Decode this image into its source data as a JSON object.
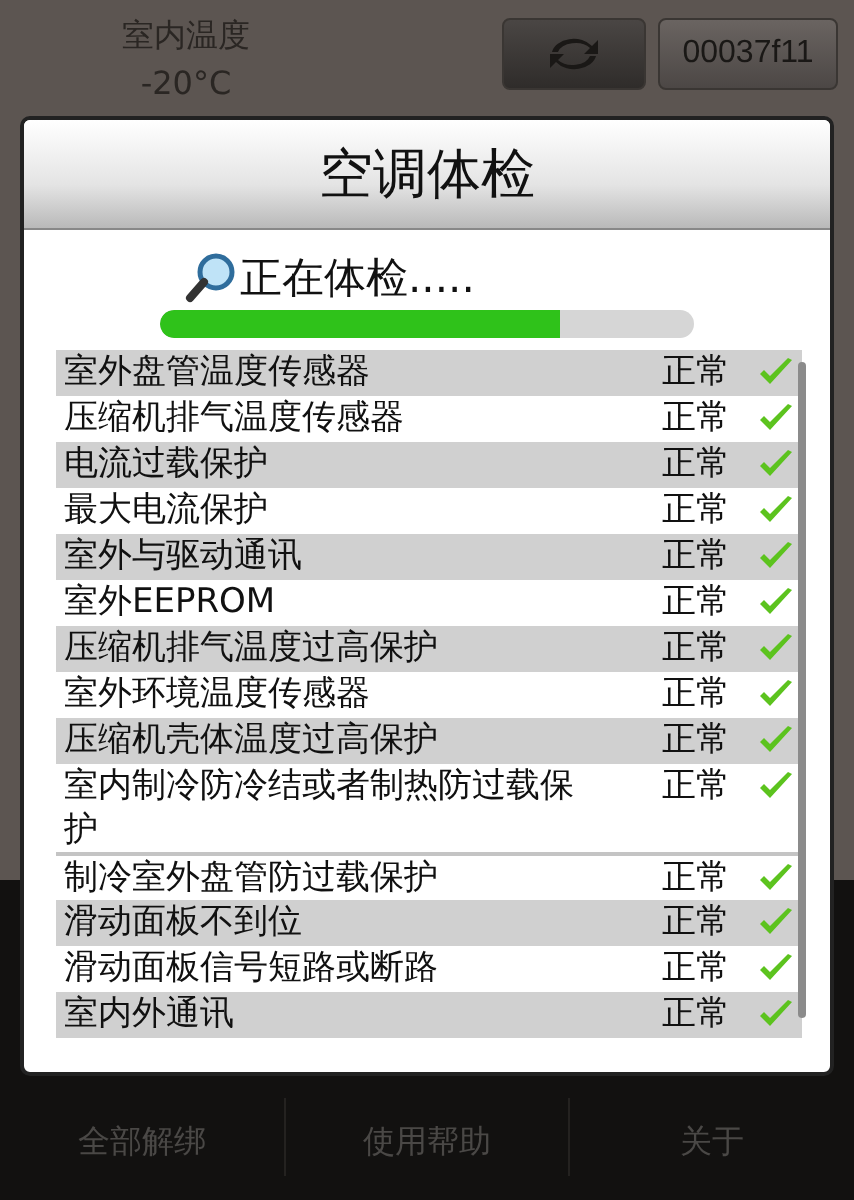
{
  "header": {
    "temperature_label": "室内温度",
    "temperature_value": "-20°C",
    "device_id": "00037f11"
  },
  "dialog": {
    "title": "空调体检",
    "status": "正在体检.....",
    "progress": {
      "level": 0.75
    },
    "items": [
      {
        "name": "室外盘管温度传感器",
        "result": "正常",
        "passed": true,
        "shaded": true
      },
      {
        "name": "压缩机排气温度传感器",
        "result": "正常",
        "passed": true,
        "shaded": false
      },
      {
        "name": "电流过载保护",
        "result": "正常",
        "passed": true,
        "shaded": true
      },
      {
        "name": "最大电流保护",
        "result": "正常",
        "passed": true,
        "shaded": false
      },
      {
        "name": "室外与驱动通讯",
        "result": "正常",
        "passed": true,
        "shaded": true
      },
      {
        "name": "室外EEPROM",
        "result": "正常",
        "passed": true,
        "shaded": false
      },
      {
        "name": "压缩机排气温度过高保护",
        "result": "正常",
        "passed": true,
        "shaded": true
      },
      {
        "name": "室外环境温度传感器",
        "result": "正常",
        "passed": true,
        "shaded": false
      },
      {
        "name": "压缩机壳体温度过高保护",
        "result": "正常",
        "passed": true,
        "shaded": true
      },
      {
        "name": "室内制冷防冷结或者制热防过载保护",
        "result": "正常",
        "passed": true,
        "shaded": false
      },
      {
        "name": "制冷室外盘管防过载保护",
        "result": "正常",
        "passed": true,
        "shaded": false
      },
      {
        "name": "滑动面板不到位",
        "result": "正常",
        "passed": true,
        "shaded": true
      },
      {
        "name": "滑动面板信号短路或断路",
        "result": "正常",
        "passed": true,
        "shaded": false
      },
      {
        "name": "室内外通讯",
        "result": "正常",
        "passed": true,
        "shaded": true
      }
    ]
  },
  "bottom_menu": [
    "全部解绑",
    "使用帮助",
    "关于"
  ]
}
